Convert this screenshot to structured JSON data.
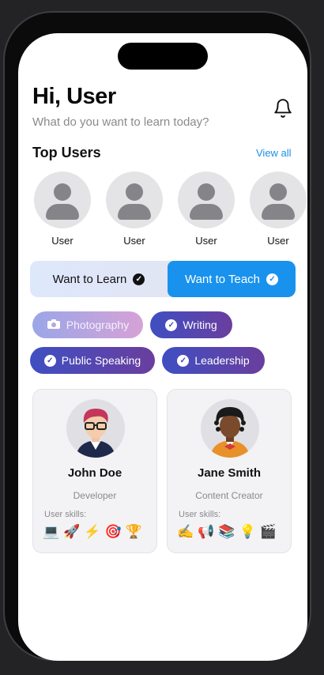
{
  "header": {
    "greeting": "Hi, User",
    "subtitle": "What do you want to learn today?"
  },
  "top_users": {
    "title": "Top Users",
    "view_all": "View all",
    "users": [
      "User",
      "User",
      "User",
      "User"
    ]
  },
  "mode_toggle": {
    "learn_label": "Want to Learn",
    "teach_label": "Want to Teach",
    "selected": "teach"
  },
  "skill_chips": [
    {
      "label": "Photography",
      "icon": "camera-icon",
      "selected": false
    },
    {
      "label": "Writing",
      "icon": "check-icon",
      "selected": true
    },
    {
      "label": "Public Speaking",
      "icon": "check-icon",
      "selected": true
    },
    {
      "label": "Leadership",
      "icon": "check-icon",
      "selected": true
    }
  ],
  "cards": [
    {
      "name": "John Doe",
      "role": "Developer",
      "skills_label": "User skills:",
      "skills": [
        "💻",
        "🚀",
        "⚡",
        "🎯",
        "🏆"
      ]
    },
    {
      "name": "Jane Smith",
      "role": "Content Creator",
      "skills_label": "User skills:",
      "skills": [
        "✍️",
        "📢",
        "📚",
        "💡",
        "🎬"
      ]
    }
  ],
  "colors": {
    "accent": "#1992ee",
    "chip_gradient_start": "#3f4fc2",
    "chip_gradient_end": "#6a3e9e",
    "link": "#1b8fe6"
  }
}
